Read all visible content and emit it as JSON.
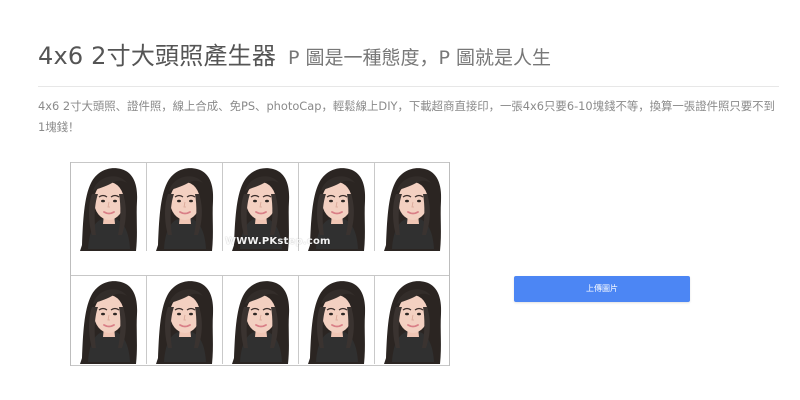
{
  "page": {
    "title": "4x6 2寸大頭照產生器",
    "subtitle": "P 圖是一種態度，P 圖就是人生",
    "description": "4x6 2寸大頭照、證件照，線上合成、免PS、photoCap，輕鬆線上DIY，下載超商直接印，一張4x6只要6-10塊錢不等，換算一張證件照只要不到1塊錢！"
  },
  "preview": {
    "watermark": "WWW.PKstep.com",
    "rows": 2,
    "columns": 5
  },
  "actions": {
    "upload_label": "上傳圖片"
  },
  "colors": {
    "upload_button": "#4c86f4",
    "background": "#ffffff"
  }
}
